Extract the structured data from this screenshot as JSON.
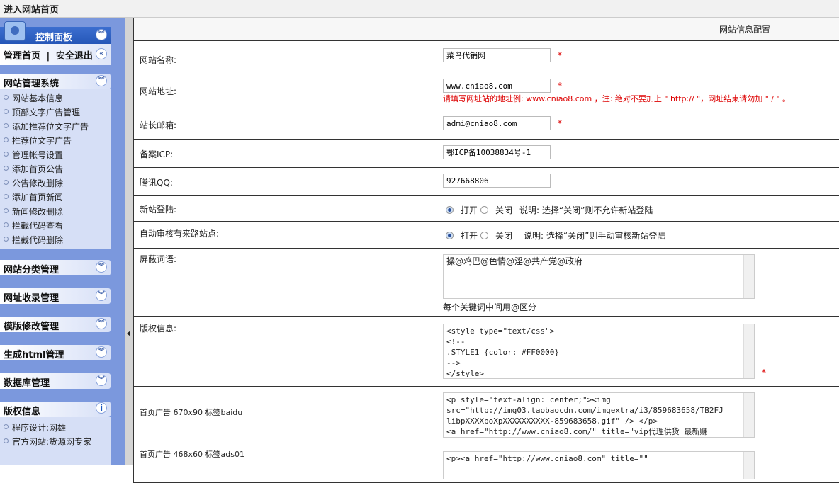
{
  "topbar": {
    "title": "进入网站首页"
  },
  "sidebar": {
    "control_panel": "控制面板",
    "home_link": "管理首页",
    "separator": "|",
    "logout_link": "安全退出",
    "sections": [
      {
        "title": "网站管理系统",
        "items": [
          "网站基本信息",
          "顶部文字广告管理",
          "添加推荐位文字广告",
          "推荐位文字广告",
          "管理帐号设置",
          "添加首页公告",
          "公告修改删除",
          "添加首页新闻",
          "新闻修改删除",
          "拦截代码查看",
          "拦截代码删除"
        ]
      },
      {
        "title": "网站分类管理"
      },
      {
        "title": "网址收录管理"
      },
      {
        "title": "模版修改管理"
      },
      {
        "title": "生成html管理"
      },
      {
        "title": "数据库管理"
      }
    ],
    "copyright": {
      "title": "版权信息",
      "items": [
        "程序设计:网雄",
        "官方网站:货源网专家"
      ]
    }
  },
  "main": {
    "header": "网站信息配置",
    "site_name": {
      "label": "网站名称:",
      "value": "菜鸟代销网"
    },
    "site_url": {
      "label": "网站地址:",
      "value": "www.cniao8.com",
      "hint": "请填写网址站的地址例: www.cniao8.com ，注: 绝对不要加上 \" http:// \"，网址结束请勿加 \" / \" 。"
    },
    "email": {
      "label": "站长邮箱:",
      "value": "admi@cniao8.com"
    },
    "icp": {
      "label": "备案ICP:",
      "value": "鄂ICP备10038834号-1"
    },
    "qq": {
      "label": "腾讯QQ:",
      "value": "927668806"
    },
    "new_site": {
      "label": "新站登陆:",
      "on": "打开",
      "off": "关闭",
      "note": "说明: 选择“关闭”则不允许新站登陆",
      "selected": "on"
    },
    "auto_review": {
      "label": "自动审核有来路站点:",
      "on": "打开",
      "off": "关闭",
      "note": "说明: 选择“关闭”则手动审核新站登陆",
      "selected": "on"
    },
    "blocked": {
      "label": "屏蔽词语:",
      "value": "操@鸡巴@色情@淫@共产党@政府",
      "hint": "每个关键词中间用@区分"
    },
    "copyright": {
      "label": "版权信息:",
      "value": "<style type=\"text/css\">\n<!--\n.STYLE1 {color: #FF0000}\n-->\n</style>"
    },
    "ad1": {
      "label": "首页广告 670x90 标签baidu",
      "value": "<p style=\"text-align: center;\"><img\nsrc=\"http://img03.taobaocdn.com/imgextra/i3/859683658/TB2FJ\nlibpXXXXboXpXXXXXXXXXX-859683658.gif\" /> </p>\n<a href=\"http://www.cniao8.com/\" title=\"vip代理供货 最新赚"
    },
    "ad2": {
      "label": "首页广告 468x60 标签ads01",
      "value": "<p><a href=\"http://www.cniao8.com\" title=\"\""
    },
    "required_mark": "*"
  }
}
